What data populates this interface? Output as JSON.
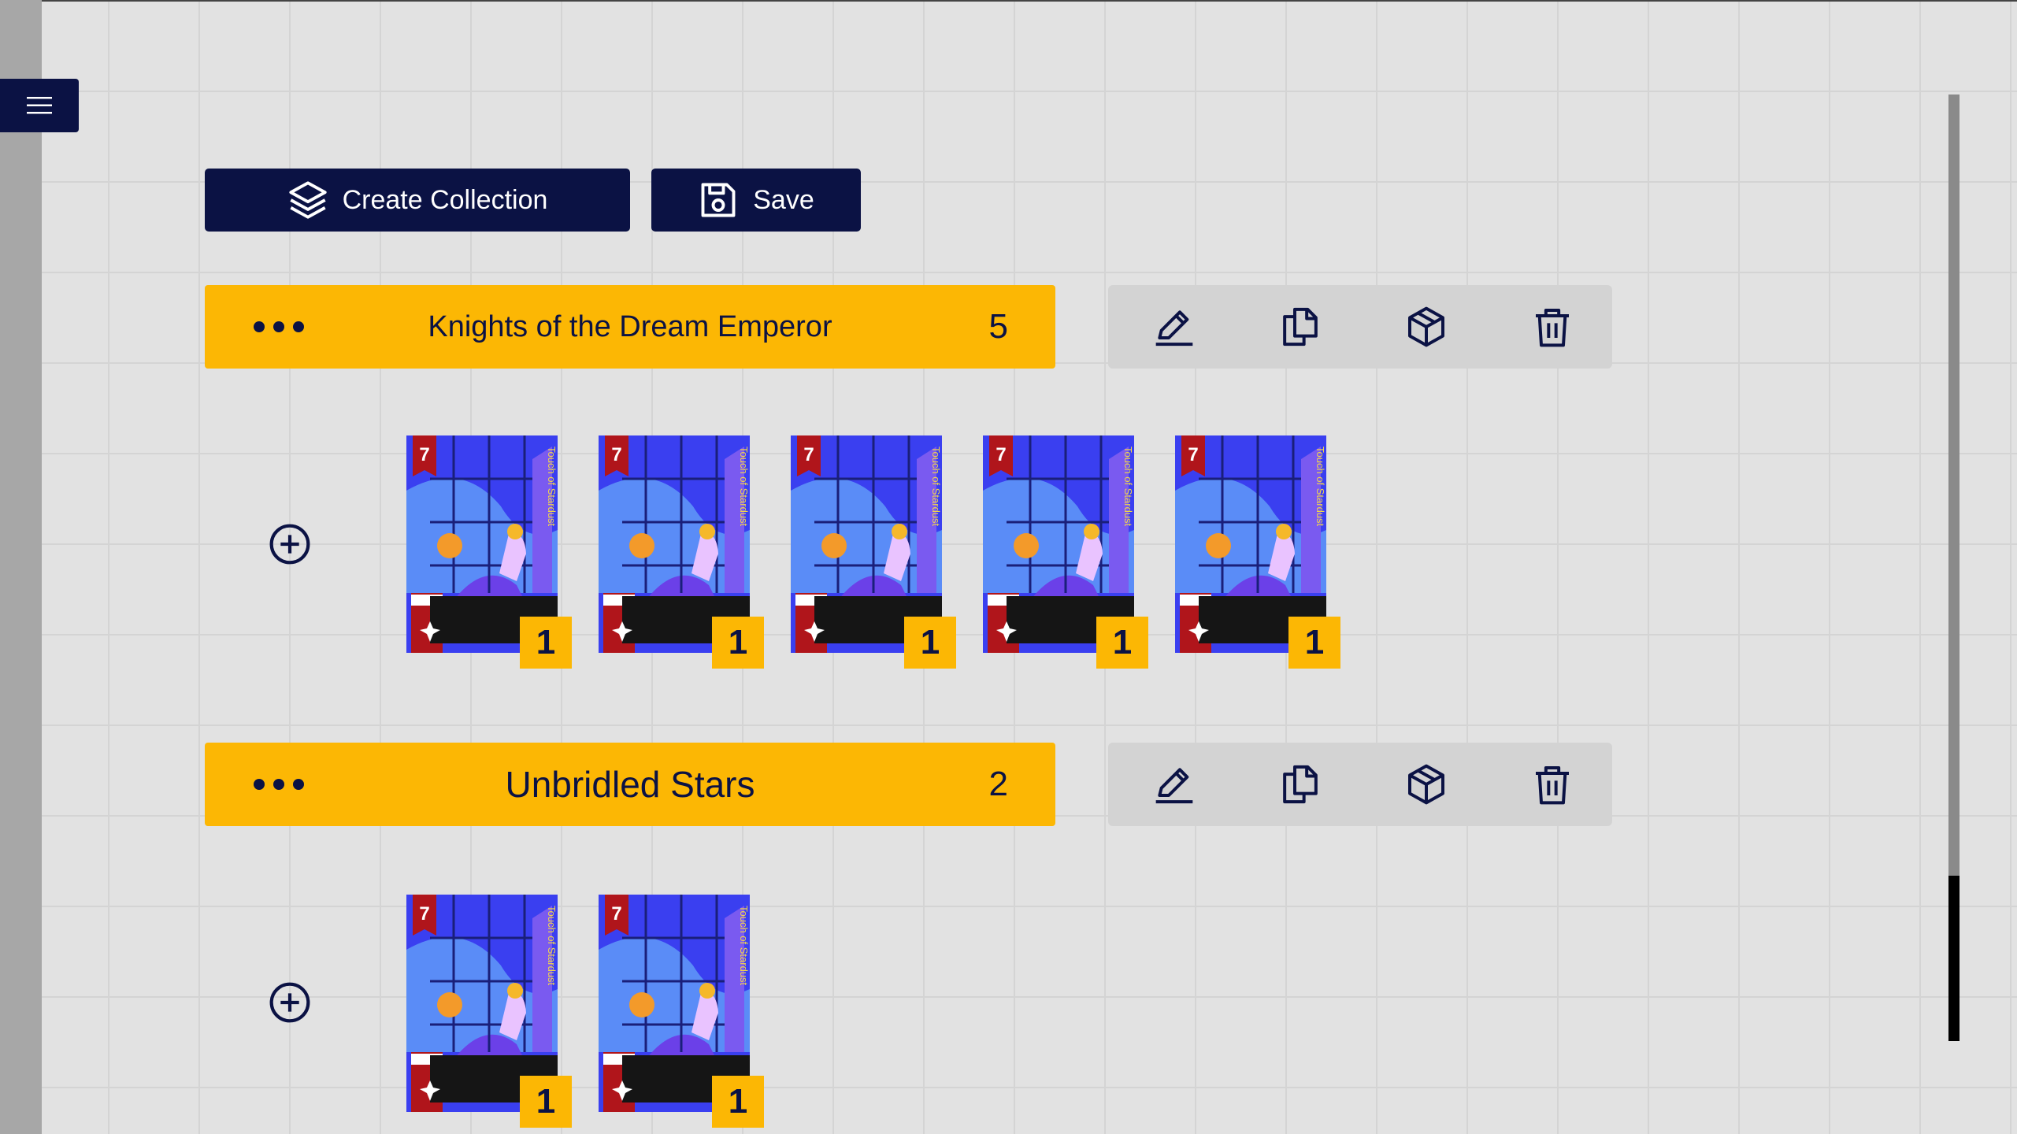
{
  "toolbar": {
    "create_label": "Create Collection",
    "save_label": "Save"
  },
  "collections": [
    {
      "name": "Knights of the Dream Emperor",
      "count": "5",
      "cards": [
        {
          "title": "Touch of Stardust",
          "cost": "7",
          "qty": "1"
        },
        {
          "title": "Touch of Stardust",
          "cost": "7",
          "qty": "1"
        },
        {
          "title": "Touch of Stardust",
          "cost": "7",
          "qty": "1"
        },
        {
          "title": "Touch of Stardust",
          "cost": "7",
          "qty": "1"
        },
        {
          "title": "Touch of Stardust",
          "cost": "7",
          "qty": "1"
        }
      ]
    },
    {
      "name": "Unbridled Stars",
      "count": "2",
      "cards": [
        {
          "title": "Touch of Stardust",
          "cost": "7",
          "qty": "1"
        },
        {
          "title": "Touch of Stardust",
          "cost": "7",
          "qty": "1"
        }
      ]
    }
  ],
  "icons": {
    "menu": "hamburger-menu-icon",
    "create": "layers-icon",
    "save": "floppy-disk-icon",
    "more": "more-dots-icon",
    "edit": "pencil-icon",
    "duplicate": "copy-icon",
    "box": "cube-icon",
    "delete": "trash-icon",
    "add": "plus-circle-icon"
  },
  "colors": {
    "navy": "#0b1244",
    "accent": "#fcb704",
    "background": "#e2e2e2",
    "card_blue": "#3a3ff0",
    "card_red": "#b0151b"
  }
}
